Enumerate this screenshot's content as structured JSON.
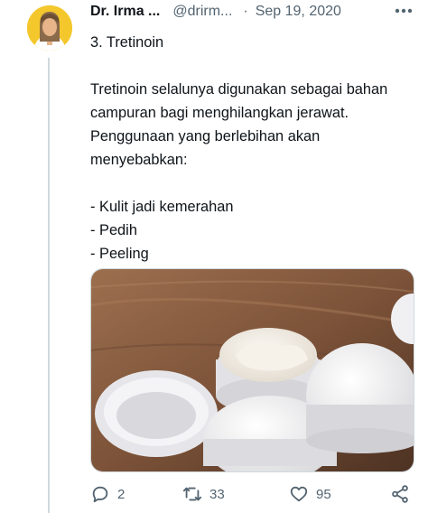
{
  "tweet": {
    "author": "Dr. Irma ...",
    "handle": "@drirm...",
    "separator": "·",
    "date": "Sep 19, 2020",
    "text": "3. Tretinoin\n\nTretinoin selalunya digunakan sebagai bahan campuran bagi menghilangkan jerawat. Penggunaan yang berlebihan akan menyebabkan:\n\n- Kulit jadi kemerahan\n- Pedih\n- Peeling"
  },
  "actions": {
    "reply_count": "2",
    "retweet_count": "33",
    "like_count": "95"
  },
  "icons": {
    "more": "more-dots-icon",
    "reply": "reply-bubble-icon",
    "retweet": "retweet-icon",
    "like": "heart-icon",
    "share": "share-icon"
  },
  "colors": {
    "text": "#0f1419",
    "secondary": "#536471",
    "thread_line": "#cfd9de",
    "avatar_bg": "#f4c72c"
  }
}
